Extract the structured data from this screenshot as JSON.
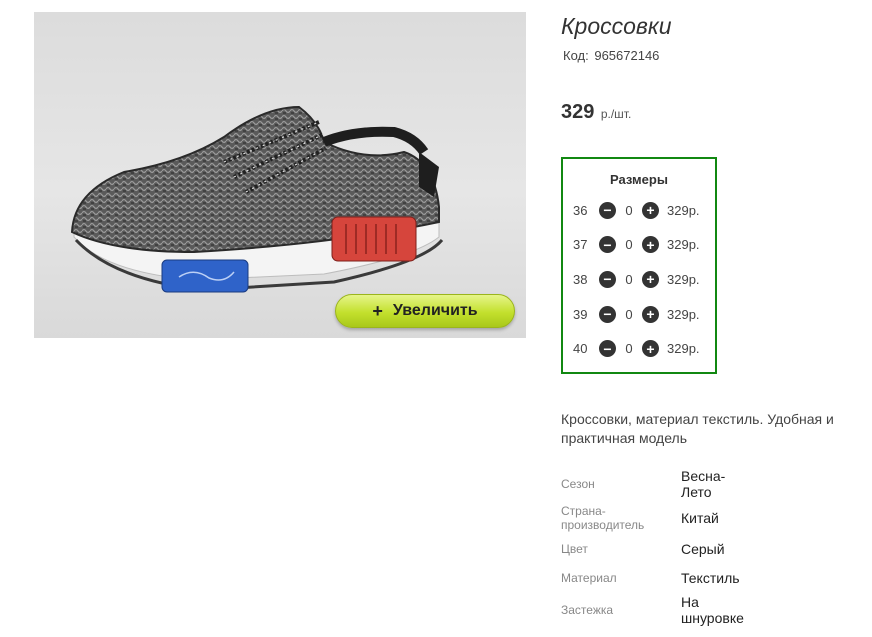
{
  "product": {
    "title": "Кроссовки",
    "code_label": "Код:",
    "code": "965672146",
    "price": "329",
    "price_unit": "р./шт.",
    "zoom_label": "Увеличить",
    "zoom_icon": "plus-icon",
    "description": "Кроссовки, материал текстиль. Удобная и практичная модель"
  },
  "sizes": {
    "heading": "Размеры",
    "rows": [
      {
        "size": "36",
        "qty": "0",
        "price": "329р."
      },
      {
        "size": "37",
        "qty": "0",
        "price": "329р."
      },
      {
        "size": "38",
        "qty": "0",
        "price": "329р."
      },
      {
        "size": "39",
        "qty": "0",
        "price": "329р."
      },
      {
        "size": "40",
        "qty": "0",
        "price": "329р."
      }
    ],
    "minus_icon": "minus-circle-icon",
    "plus_icon": "plus-circle-icon",
    "border_color": "#118811"
  },
  "properties": [
    {
      "key": "Сезон",
      "value": "Весна-Лето"
    },
    {
      "key": "Страна-производитель",
      "value": "Китай"
    },
    {
      "key": "Цвет",
      "value": "Серый"
    },
    {
      "key": "Материал",
      "value": "Текстиль"
    },
    {
      "key": "Застежка",
      "value": "На шнуровке"
    }
  ],
  "colors": {
    "zoom_button": "#c3e02d",
    "sole_red": "#d6453c",
    "sole_blue": "#2f63c9"
  }
}
